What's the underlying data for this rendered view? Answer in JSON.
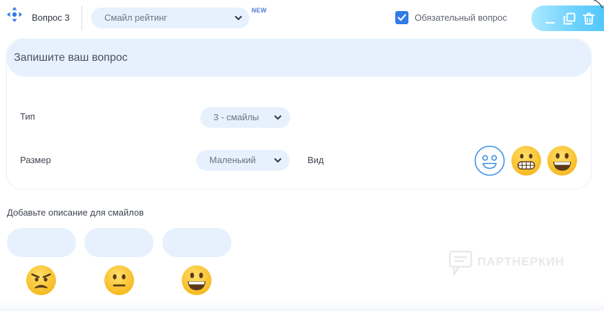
{
  "header": {
    "question_label": "Вопрос 3",
    "type_select": {
      "value": "Смайл рейтинг"
    },
    "new_badge": "NEW",
    "required": {
      "label": "Обязательный вопрос",
      "checked": true
    }
  },
  "question": {
    "placeholder": "Запишите ваш вопрос"
  },
  "settings": {
    "type_label": "Тип",
    "type_value": "3 - смайлы",
    "size_label": "Размер",
    "size_value": "Маленький",
    "view_label": "Вид",
    "view_options": [
      "outline-smile-icon",
      "grimacing-emoji-icon",
      "grinning-emoji-icon"
    ]
  },
  "descriptions": {
    "title": "Добавьте описание для смайлов",
    "items": [
      {
        "value": "",
        "emoji": "angry-emoji-icon"
      },
      {
        "value": "",
        "emoji": "neutral-emoji-icon"
      },
      {
        "value": "",
        "emoji": "grinning-emoji-icon"
      }
    ]
  },
  "watermark": {
    "text": "ПАРТНЕРКИН"
  },
  "colors": {
    "accent": "#2f7be8",
    "field_bg": "#e6f1fd",
    "emoji_yellow": "#fdd049",
    "action_gradient": [
      "#ade9ff",
      "#4ec6fb"
    ]
  }
}
